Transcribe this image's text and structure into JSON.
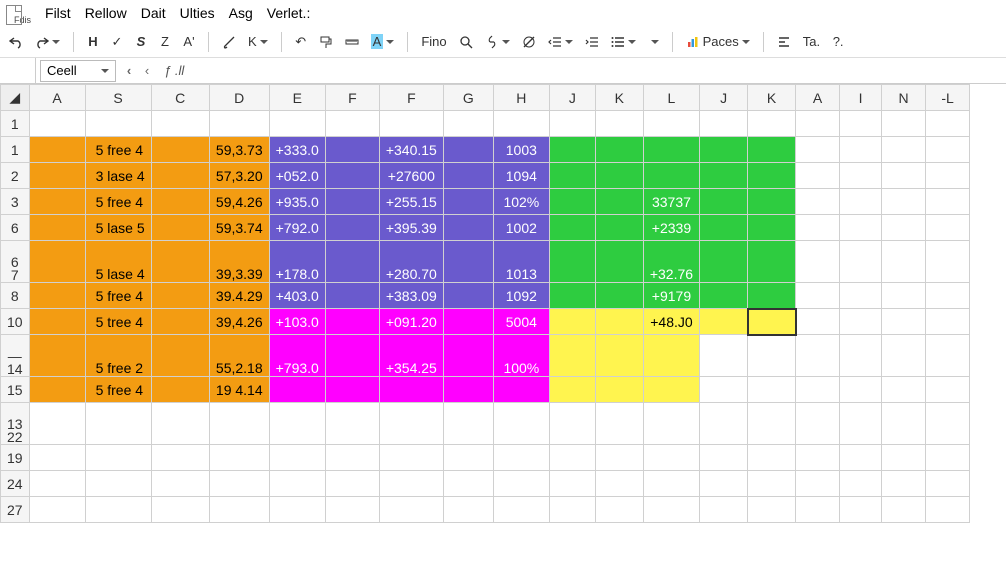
{
  "app": {
    "file_label": "Fdis"
  },
  "menu": {
    "items": [
      "Filst",
      "Rellow",
      "Dait",
      "Ulties",
      "Asg",
      "Verlet.:"
    ]
  },
  "toolbar": {
    "undo": "undo-icon",
    "redo": "redo-icon",
    "h": "H",
    "check": "✓",
    "s": "S",
    "z": "Z",
    "a2": "A'",
    "brush": "brush-icon",
    "k": "K",
    "rotl": "↶",
    "paint": "format-paint-icon",
    "ruler": "ruler-icon",
    "hla": "A",
    "fino": "Fino",
    "search": "search-icon",
    "link": "link-icon",
    "strike": "strike-icon",
    "outdent": "outdent-icon",
    "indent": "indent-icon",
    "list": "list-icon",
    "paces": "Paces",
    "align": "align-icon",
    "ta": "Ta.",
    "q": "?."
  },
  "fx": {
    "namebox": "Ceell",
    "back": "‹",
    "fwd": "‹",
    "func": "ƒ .ll"
  },
  "grid": {
    "col_headers": [
      "A",
      "S",
      "C",
      "D",
      "E",
      "F",
      "F",
      "G",
      "H",
      "J",
      "K",
      "L",
      "J",
      "K",
      "A",
      "I",
      "N",
      "-L"
    ],
    "row_headers": [
      "1",
      "1",
      "2",
      "3",
      "6",
      "6\n7",
      "8",
      "10",
      "—\n14",
      "15",
      "13\n22",
      "19",
      "24",
      "27"
    ]
  },
  "chart_data": {
    "type": "table",
    "rows": [
      {
        "A": "",
        "S": "5 free 4",
        "C": "",
        "D": "59,3.73",
        "E": "+333.0",
        "F1": "",
        "F2": "+340.15",
        "G": "",
        "H": "1003",
        "J1": "",
        "K1": "",
        "L": "",
        "J2": "",
        "K2": ""
      },
      {
        "A": "",
        "S": "3 lase 4",
        "C": "",
        "D": "57,3.20",
        "E": "+052.0",
        "F1": "",
        "F2": "+27600",
        "G": "",
        "H": "1094",
        "J1": "",
        "K1": "",
        "L": "",
        "J2": "",
        "K2": ""
      },
      {
        "A": "",
        "S": "5 free 4",
        "C": "",
        "D": "59,4.26",
        "E": "+935.0",
        "F1": "",
        "F2": "+255.15",
        "G": "",
        "H": "102%",
        "J1": "",
        "K1": "",
        "L": "33737",
        "J2": "",
        "K2": ""
      },
      {
        "A": "",
        "S": "5 lase 5",
        "C": "",
        "D": "59,3.74",
        "E": "+792.0",
        "F1": "",
        "F2": "+395.39",
        "G": "",
        "H": "1002",
        "J1": "",
        "K1": "",
        "L": "+2339",
        "J2": "",
        "K2": ""
      },
      {
        "A": "",
        "S": "5 lase 4",
        "C": "",
        "D": "39,3.39",
        "E": "+178.0",
        "F1": "",
        "F2": "+280.70",
        "G": "",
        "H": "1013",
        "J1": "",
        "K1": "",
        "L": "+32.76",
        "J2": "",
        "K2": ""
      },
      {
        "A": "",
        "S": "5 free 4",
        "C": "",
        "D": "39.4.29",
        "E": "+403.0",
        "F1": "",
        "F2": "+383.09",
        "G": "",
        "H": "1092",
        "J1": "",
        "K1": "",
        "L": "+9179",
        "J2": "",
        "K2": ""
      },
      {
        "A": "",
        "S": "5 tree 4",
        "C": "",
        "D": "39,4.26",
        "E": "+103.0",
        "F1": "",
        "F2": "+091.20",
        "G": "",
        "H": "5004",
        "J1": "",
        "K1": "",
        "L": "+48.J0",
        "J2": "",
        "K2": ""
      },
      {
        "A": "",
        "S": "5 free 2",
        "C": "",
        "D": "55,2.18",
        "E": "+793.0",
        "F1": "",
        "F2": "+354.25",
        "G": "",
        "H": "100%",
        "J1": "",
        "K1": "",
        "L": "",
        "J2": "",
        "K2": ""
      },
      {
        "A": "",
        "S": "5 free 4",
        "C": "",
        "D": "19 4.14",
        "E": "",
        "F1": "",
        "F2": "",
        "G": "",
        "H": "",
        "J1": "",
        "K1": "",
        "L": "",
        "J2": "",
        "K2": ""
      }
    ]
  }
}
